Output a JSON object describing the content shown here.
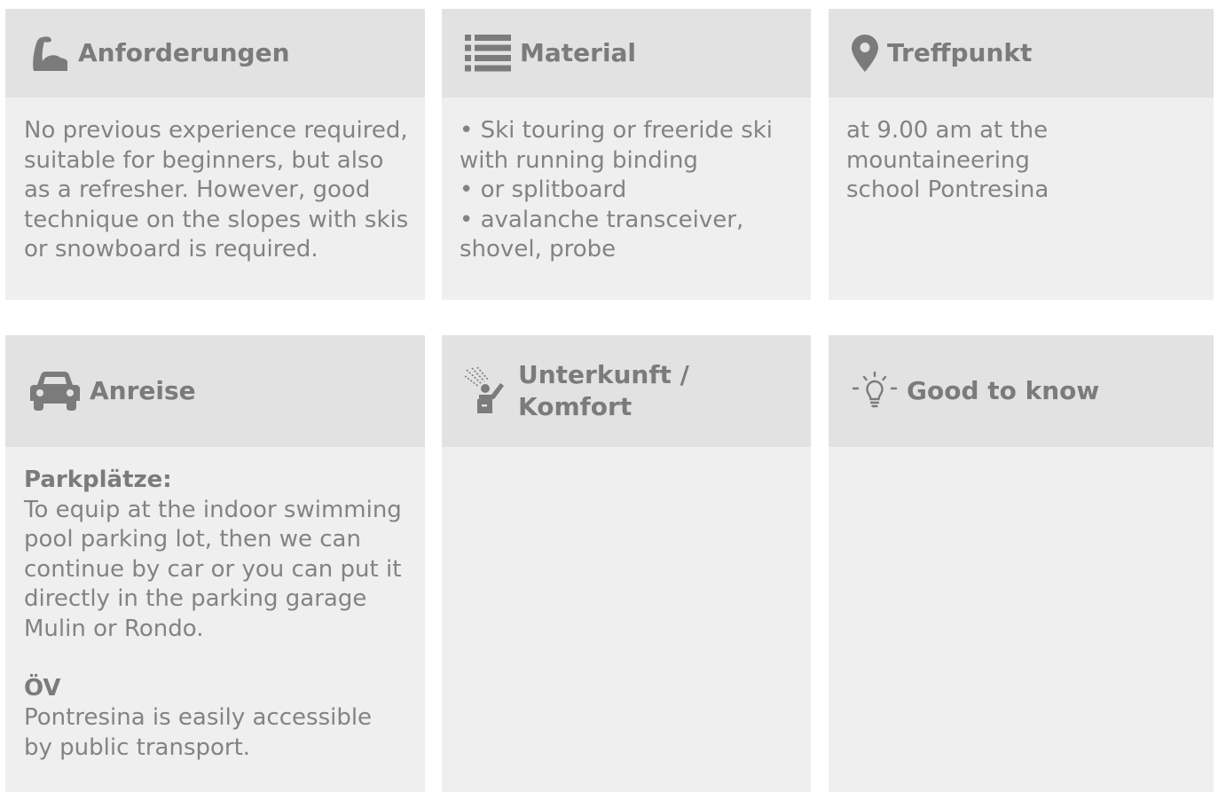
{
  "colors": {
    "card_background": "#efefef",
    "header_background": "#e2e2e2",
    "text": "#838383",
    "heading_text": "#7b7b7b",
    "icon": "#7b7b7b"
  },
  "cards": {
    "anforderungen": {
      "icon": "flexed-bicep-icon",
      "title": "Anforderungen",
      "body": "No previous experience required, suitable for beginners, but also as a refresher. However, good technique on the slopes with skis or snowboard is required."
    },
    "material": {
      "icon": "list-icon",
      "title": "Material",
      "items": [
        "• Ski touring or freeride ski with running binding",
        "• or splitboard",
        "• avalanche transceiver, shovel, probe"
      ]
    },
    "treffpunkt": {
      "icon": "map-pin-icon",
      "title": "Treffpunkt",
      "body": "at 9.00 am at the mountaineering school Pontresina"
    },
    "anreise": {
      "icon": "car-icon",
      "title": "Anreise",
      "parking_heading": "Parkplätze:",
      "parking_text": "To equip at the indoor swimming pool parking lot, then we can continue by car or you can put it directly in the parking garage Mulin or Rondo.",
      "transit_heading": "ÖV",
      "transit_text": "Pontresina is easily accessible by public transport."
    },
    "unterkunft": {
      "icon": "shower-icon",
      "title_line1": "Unterkunft /",
      "title_line2": "Komfort"
    },
    "good_to_know": {
      "icon": "lightbulb-icon",
      "title": "Good to know"
    }
  }
}
